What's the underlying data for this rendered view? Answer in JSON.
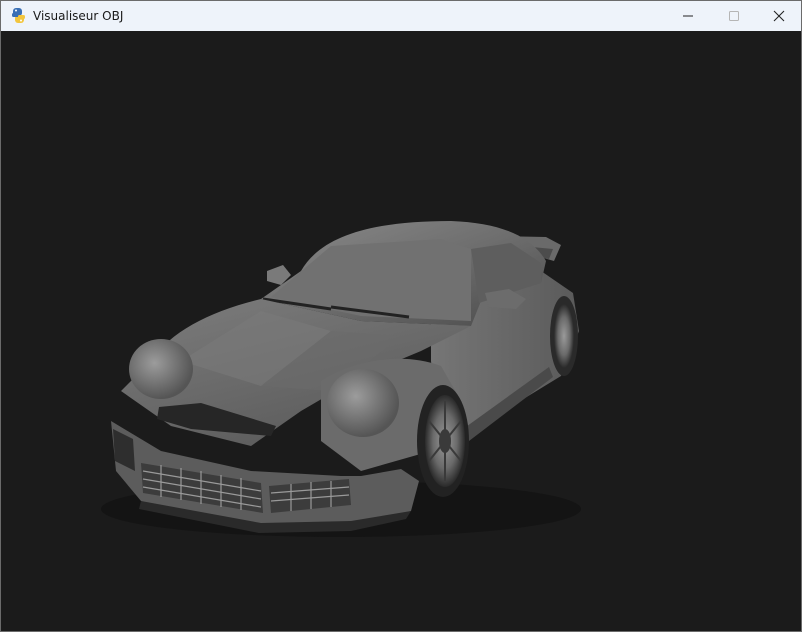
{
  "window": {
    "title": "Visualiseur OBJ",
    "app_icon": "python-snake-icon",
    "controls": [
      "minimize-icon",
      "maximize-icon",
      "close-icon"
    ]
  },
  "viewport": {
    "background": "#1b1b1b",
    "model": "car-3d-model"
  }
}
